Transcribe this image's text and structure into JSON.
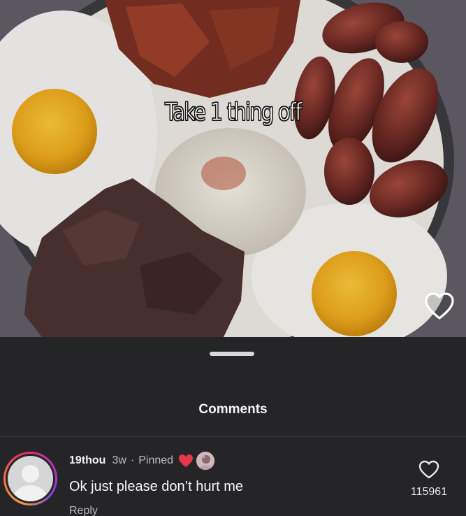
{
  "video": {
    "caption": "Take 1 thing off"
  },
  "comments_sheet": {
    "title": "Comments"
  },
  "pinned_comment": {
    "username": "19thou",
    "time": "3w",
    "separator": "·",
    "pinned_label": "Pinned",
    "text": "Ok just please don’t hurt me",
    "reply_label": "Reply",
    "like_count": "115961",
    "liked_by_creator_color": "#e8364b"
  },
  "icons": {
    "video_like": "heart-outline-icon",
    "comment_like": "heart-outline-icon",
    "creator_like": "filled-heart-icon"
  },
  "colors": {
    "sheet_background": "#252527",
    "avatar_ring_gradient": [
      "#f9a13a",
      "#e82f6d",
      "#8a3ee0"
    ]
  }
}
